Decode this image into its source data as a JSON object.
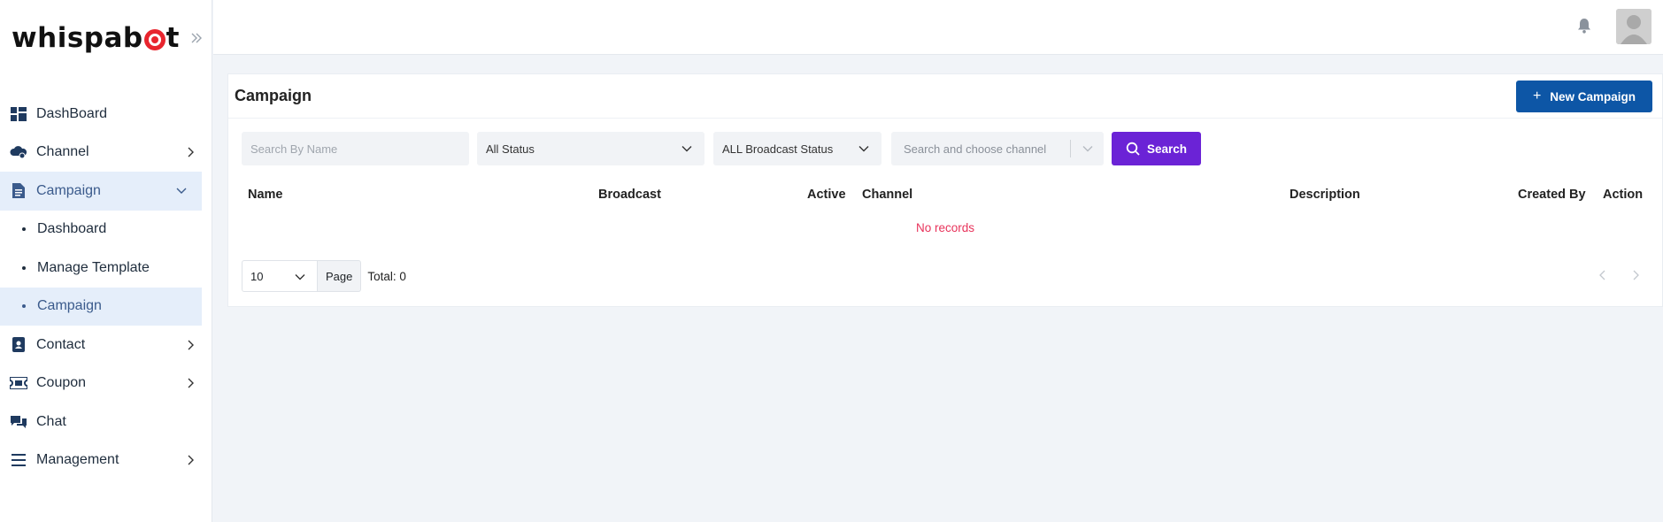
{
  "brand": {
    "logo_text_left": "whispab",
    "logo_text_right": "t"
  },
  "sidebar": {
    "items": [
      {
        "label": "DashBoard",
        "icon": "grid-icon"
      },
      {
        "label": "Channel",
        "icon": "cloud-gear-icon"
      },
      {
        "label": "Campaign",
        "icon": "document-icon",
        "expanded": true,
        "children": [
          {
            "label": "Dashboard"
          },
          {
            "label": "Manage Template"
          },
          {
            "label": "Campaign",
            "active": true
          }
        ]
      },
      {
        "label": "Contact",
        "icon": "contact-card-icon"
      },
      {
        "label": "Coupon",
        "icon": "ticket-icon"
      },
      {
        "label": "Chat",
        "icon": "chat-bubbles-icon"
      },
      {
        "label": "Management",
        "icon": "menu-lines-icon"
      }
    ]
  },
  "page": {
    "title": "Campaign",
    "new_button": "New Campaign"
  },
  "filters": {
    "search_placeholder": "Search By Name",
    "status": "All Status",
    "broadcast_status": "ALL Broadcast Status",
    "channel_placeholder": "Search and choose channel",
    "search_button": "Search"
  },
  "table": {
    "columns": [
      "Name",
      "Broadcast",
      "Active",
      "Channel",
      "Description",
      "Created By",
      "Action"
    ],
    "empty_text": "No records"
  },
  "pagination": {
    "page_size": "10",
    "page_label": "Page",
    "total": "Total: 0"
  },
  "colors": {
    "primary": "#0d56a6",
    "search": "#6b23d6",
    "active_bg": "#e5eefa",
    "empty": "#e8335b"
  }
}
